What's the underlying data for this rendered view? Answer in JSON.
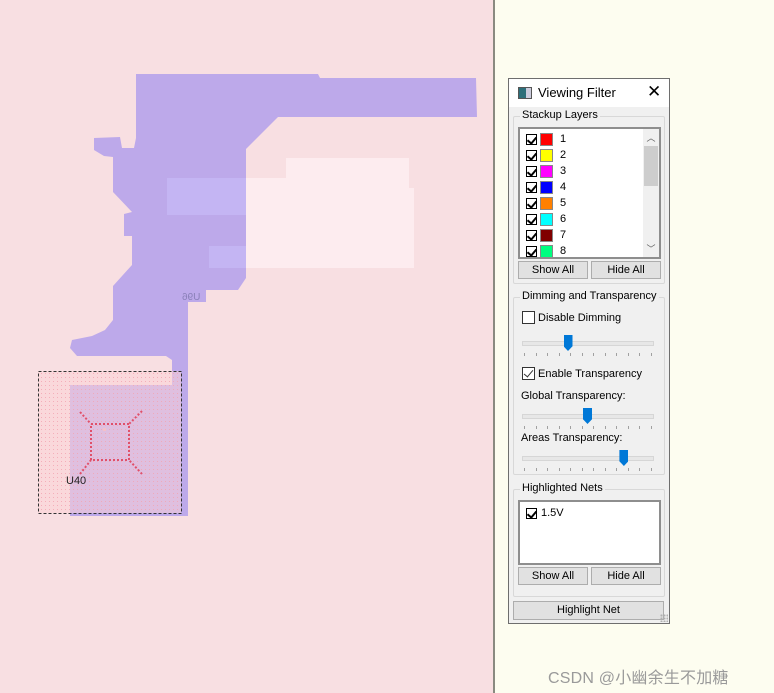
{
  "canvas": {
    "background": "#f8dfe2",
    "copper_color": "#bda9ea",
    "components": [
      {
        "ref": "U96",
        "mirrored": true
      },
      {
        "ref": "U40",
        "mirrored": false
      }
    ]
  },
  "viewing_filter": {
    "title": "Viewing Filter",
    "close_icon": "close-icon",
    "stackup_layers": {
      "title": "Stackup Layers",
      "layers": [
        {
          "name": "1",
          "checked": true,
          "color": "#ff0000"
        },
        {
          "name": "2",
          "checked": true,
          "color": "#ffff00"
        },
        {
          "name": "3",
          "checked": true,
          "color": "#ff00ff"
        },
        {
          "name": "4",
          "checked": true,
          "color": "#0000ff"
        },
        {
          "name": "5",
          "checked": true,
          "color": "#ff8000"
        },
        {
          "name": "6",
          "checked": true,
          "color": "#00ffff"
        },
        {
          "name": "7",
          "checked": true,
          "color": "#800000"
        },
        {
          "name": "8",
          "checked": true,
          "color": "#00ff80"
        }
      ],
      "show_all_label": "Show All",
      "hide_all_label": "Hide All"
    },
    "dimming": {
      "title": "Dimming and Transparency",
      "disable_dimming_label": "Disable Dimming",
      "disable_dimming_checked": false,
      "dimming_level": 0.35,
      "enable_transparency_label": "Enable Transparency",
      "enable_transparency_checked": true,
      "global_transparency_label": "Global Transparency:",
      "global_transparency": 0.5,
      "areas_transparency_label": "Areas Transparency:",
      "areas_transparency": 0.78
    },
    "highlighted_nets": {
      "title": "Highlighted Nets",
      "nets": [
        {
          "name": "1.5V",
          "checked": true
        }
      ],
      "show_all_label": "Show All",
      "hide_all_label": "Hide All"
    },
    "highlight_net_label": "Highlight Net"
  },
  "watermark": "CSDN @小幽余生不加糖"
}
